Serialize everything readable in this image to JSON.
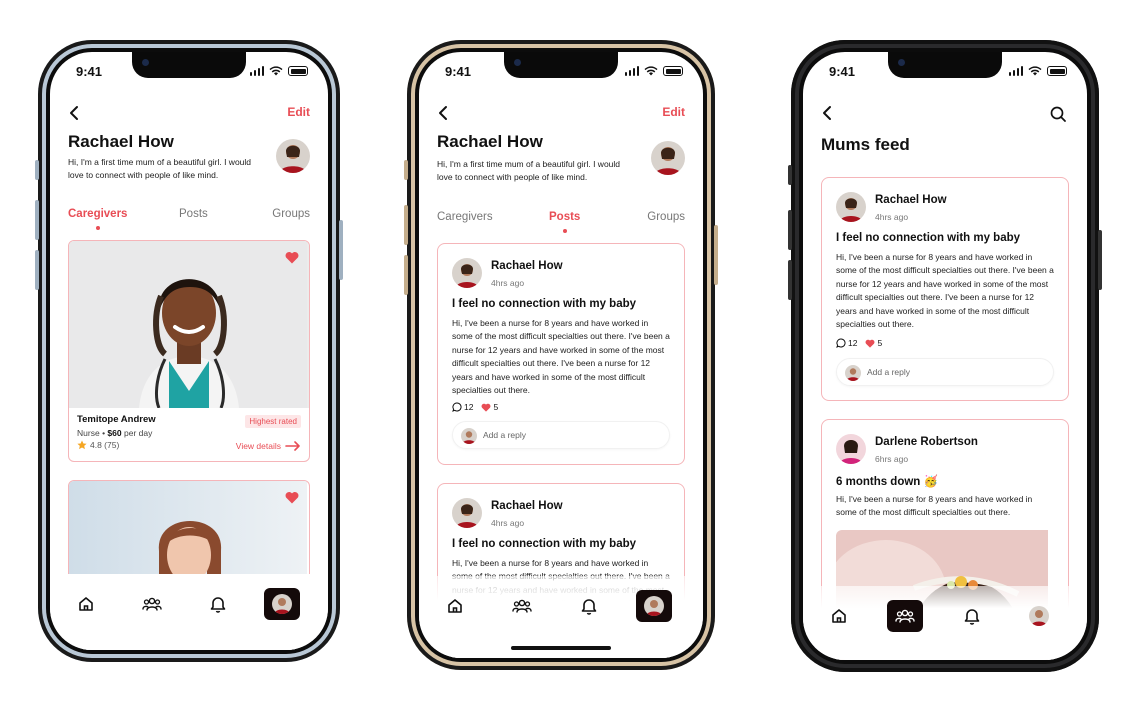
{
  "colors": {
    "accent": "#e84d55",
    "card_border": "#f5b5b9",
    "nav_active_bg": "#140a0a"
  },
  "status_bar": {
    "time": "9:41"
  },
  "profile": {
    "name": "Rachael How",
    "edit_label": "Edit",
    "bio": "Hi, I'm a first time mum of a beautiful girl. I would love to connect with people of like mind.",
    "tabs": [
      "Caregivers",
      "Posts",
      "Groups"
    ]
  },
  "caregiver": {
    "name": "Temitope Andrew",
    "role": "Nurse",
    "separator": "•",
    "price": "$60",
    "price_unit": "per day",
    "rating": "4.8 (75)",
    "badge": "Highest rated",
    "view_details": "View details"
  },
  "post": {
    "author": "Rachael How",
    "time_ago": "4hrs ago",
    "title": "I feel no connection with my baby",
    "body": "Hi, I've been a nurse for 8 years and have worked in some of the most difficult specialties out there. I've been a nurse for 12 years and have worked in some of the most difficult specialties out there. I've been a nurse for 12 years and have worked in some of the most difficult specialties out there.",
    "comments": "12",
    "likes": "5",
    "reply_placeholder": "Add a reply"
  },
  "feed": {
    "title": "Mums feed",
    "post2": {
      "author": "Darlene Robertson",
      "time_ago": "6hrs ago",
      "title": "6 months down 🥳",
      "body": "Hi, I've been a nurse for 8 years and have worked in some of the most difficult specialties out there."
    }
  },
  "nav_icons": [
    "home-icon",
    "community-icon",
    "bell-icon",
    "profile-avatar"
  ]
}
